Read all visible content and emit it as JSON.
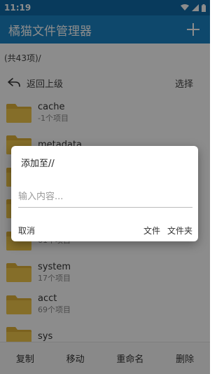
{
  "status_bar": {
    "time": "11:19"
  },
  "app_bar": {
    "title": "橘猫文件管理器"
  },
  "path": {
    "text": "(共43项)/"
  },
  "nav": {
    "back_label": "返回上级",
    "select_label": "选择"
  },
  "files": [
    {
      "name": "cache",
      "meta": "-1个项目"
    },
    {
      "name": "metadata",
      "meta": ""
    },
    {
      "name": "",
      "meta": ""
    },
    {
      "name": "",
      "meta": ""
    },
    {
      "name": "",
      "meta": "61个项目"
    },
    {
      "name": "system",
      "meta": "17个项目"
    },
    {
      "name": "acct",
      "meta": "69个项目"
    },
    {
      "name": "sys",
      "meta": ""
    }
  ],
  "bottom_bar": {
    "copy": "复制",
    "move": "移动",
    "rename": "重命名",
    "delete": "删除"
  },
  "dialog": {
    "title": "添加至//",
    "input_placeholder": "输入内容...",
    "input_value": "",
    "cancel_label": "取消",
    "file_label": "文件",
    "folder_label": "文件夹"
  },
  "colors": {
    "status_bar": "#0f6ba8",
    "app_bar": "#1a83c5",
    "folder": "#f2c94c",
    "folder_tab": "#e0b23a"
  }
}
